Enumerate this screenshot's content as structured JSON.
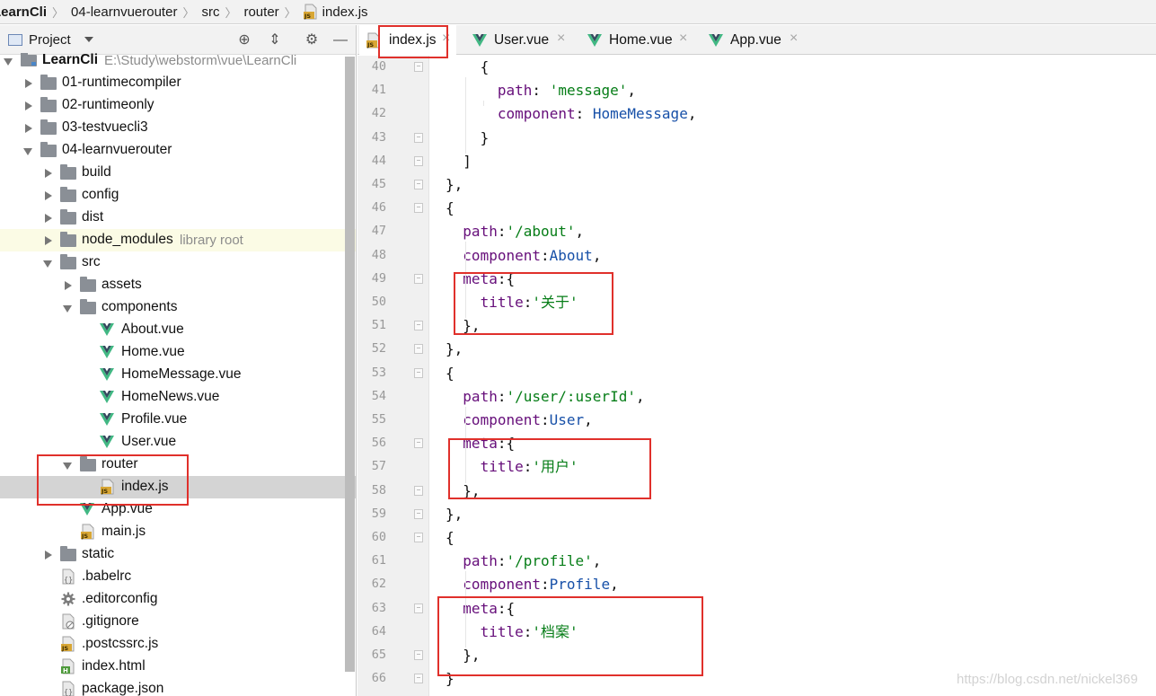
{
  "breadcrumb": [
    "LearnCli",
    "04-learnvuerouter",
    "src",
    "router",
    "index.js"
  ],
  "project_panel": {
    "title": "Project",
    "tools": [
      "crosshair-icon",
      "collapse-icon",
      "gear-icon",
      "minimize-icon"
    ],
    "tree": [
      {
        "label": "LearnCli",
        "hint": "E:\\Study\\webstorm\\vue\\LearnCli",
        "kind": "module",
        "depth": 0,
        "state": "open",
        "bold": true
      },
      {
        "label": "01-runtimecompiler",
        "kind": "folder",
        "depth": 1,
        "state": "closed"
      },
      {
        "label": "02-runtimeonly",
        "kind": "folder",
        "depth": 1,
        "state": "closed"
      },
      {
        "label": "03-testvuecli3",
        "kind": "folder",
        "depth": 1,
        "state": "closed"
      },
      {
        "label": "04-learnvuerouter",
        "kind": "folder",
        "depth": 1,
        "state": "open"
      },
      {
        "label": "build",
        "kind": "folder",
        "depth": 2,
        "state": "closed"
      },
      {
        "label": "config",
        "kind": "folder",
        "depth": 2,
        "state": "closed"
      },
      {
        "label": "dist",
        "kind": "folder",
        "depth": 2,
        "state": "closed"
      },
      {
        "label": "node_modules",
        "hint": "library root",
        "kind": "folder",
        "depth": 2,
        "state": "closed",
        "libroot": true
      },
      {
        "label": "src",
        "kind": "folder",
        "depth": 2,
        "state": "open"
      },
      {
        "label": "assets",
        "kind": "folder",
        "depth": 3,
        "state": "closed"
      },
      {
        "label": "components",
        "kind": "folder",
        "depth": 3,
        "state": "open"
      },
      {
        "label": "About.vue",
        "kind": "vue",
        "depth": 4
      },
      {
        "label": "Home.vue",
        "kind": "vue",
        "depth": 4
      },
      {
        "label": "HomeMessage.vue",
        "kind": "vue",
        "depth": 4
      },
      {
        "label": "HomeNews.vue",
        "kind": "vue",
        "depth": 4
      },
      {
        "label": "Profile.vue",
        "kind": "vue",
        "depth": 4
      },
      {
        "label": "User.vue",
        "kind": "vue",
        "depth": 4
      },
      {
        "label": "router",
        "kind": "folder",
        "depth": 3,
        "state": "open"
      },
      {
        "label": "index.js",
        "kind": "js",
        "depth": 4,
        "selected": true
      },
      {
        "label": "App.vue",
        "kind": "vue",
        "depth": 3
      },
      {
        "label": "main.js",
        "kind": "js",
        "depth": 3
      },
      {
        "label": "static",
        "kind": "folder",
        "depth": 2,
        "state": "closed"
      },
      {
        "label": ".babelrc",
        "kind": "config",
        "depth": 2
      },
      {
        "label": ".editorconfig",
        "kind": "settings",
        "depth": 2
      },
      {
        "label": ".gitignore",
        "kind": "ignore",
        "depth": 2
      },
      {
        "label": ".postcssrc.js",
        "kind": "js",
        "depth": 2
      },
      {
        "label": "index.html",
        "kind": "html",
        "depth": 2
      },
      {
        "label": "package.json",
        "kind": "config",
        "depth": 2
      }
    ]
  },
  "editor": {
    "tabs": [
      {
        "label": "index.js",
        "kind": "js",
        "active": true
      },
      {
        "label": "User.vue",
        "kind": "vue"
      },
      {
        "label": "Home.vue",
        "kind": "vue"
      },
      {
        "label": "App.vue",
        "kind": "vue"
      }
    ],
    "lines": [
      {
        "n": 40,
        "fold": true,
        "indent": 2,
        "tokens": [
          [
            "{",
            "p"
          ]
        ]
      },
      {
        "n": 41,
        "indent": 3,
        "tokens": [
          [
            "path",
            "k"
          ],
          [
            ": ",
            "p"
          ],
          [
            "'message'",
            "s"
          ],
          [
            ",",
            "p"
          ]
        ]
      },
      {
        "n": 42,
        "indent": 3,
        "tokens": [
          [
            "component",
            "k"
          ],
          [
            ": ",
            "p"
          ],
          [
            "HomeMessage",
            "i"
          ],
          [
            ",",
            "p"
          ]
        ]
      },
      {
        "n": 43,
        "fold": true,
        "indent": 2,
        "tokens": [
          [
            "}",
            "p"
          ]
        ]
      },
      {
        "n": 44,
        "fold": true,
        "indent": 1,
        "tokens": [
          [
            "]",
            "p"
          ]
        ]
      },
      {
        "n": 45,
        "fold": true,
        "indent": 0,
        "tokens": [
          [
            "},",
            "p"
          ]
        ]
      },
      {
        "n": 46,
        "fold": true,
        "indent": 0,
        "tokens": [
          [
            "{",
            "p"
          ]
        ]
      },
      {
        "n": 47,
        "indent": 1,
        "tokens": [
          [
            "path",
            "k"
          ],
          [
            ":",
            "p"
          ],
          [
            "'/about'",
            "s"
          ],
          [
            ",",
            "p"
          ]
        ]
      },
      {
        "n": 48,
        "indent": 1,
        "tokens": [
          [
            "component",
            "k"
          ],
          [
            ":",
            "p"
          ],
          [
            "About",
            "i"
          ],
          [
            ",",
            "p"
          ]
        ]
      },
      {
        "n": 49,
        "fold": true,
        "indent": 1,
        "tokens": [
          [
            "meta",
            "k"
          ],
          [
            ":{",
            "p"
          ]
        ]
      },
      {
        "n": 50,
        "indent": 2,
        "tokens": [
          [
            "title",
            "k"
          ],
          [
            ":",
            "p"
          ],
          [
            "'关于'",
            "s"
          ]
        ]
      },
      {
        "n": 51,
        "fold": true,
        "indent": 1,
        "tokens": [
          [
            "},",
            "p"
          ]
        ]
      },
      {
        "n": 52,
        "fold": true,
        "indent": 0,
        "tokens": [
          [
            "},",
            "p"
          ]
        ]
      },
      {
        "n": 53,
        "fold": true,
        "indent": 0,
        "tokens": [
          [
            "{",
            "p"
          ]
        ]
      },
      {
        "n": 54,
        "indent": 1,
        "tokens": [
          [
            "path",
            "k"
          ],
          [
            ":",
            "p"
          ],
          [
            "'/user/:userId'",
            "s"
          ],
          [
            ",",
            "p"
          ]
        ]
      },
      {
        "n": 55,
        "indent": 1,
        "tokens": [
          [
            "component",
            "k"
          ],
          [
            ":",
            "p"
          ],
          [
            "User",
            "i"
          ],
          [
            ",",
            "p"
          ]
        ]
      },
      {
        "n": 56,
        "fold": true,
        "indent": 1,
        "tokens": [
          [
            "meta",
            "k"
          ],
          [
            ":{",
            "p"
          ]
        ]
      },
      {
        "n": 57,
        "indent": 2,
        "tokens": [
          [
            "title",
            "k"
          ],
          [
            ":",
            "p"
          ],
          [
            "'用户'",
            "s"
          ]
        ]
      },
      {
        "n": 58,
        "fold": true,
        "indent": 1,
        "tokens": [
          [
            "},",
            "p"
          ]
        ]
      },
      {
        "n": 59,
        "fold": true,
        "indent": 0,
        "tokens": [
          [
            "},",
            "p"
          ]
        ]
      },
      {
        "n": 60,
        "fold": true,
        "indent": 0,
        "tokens": [
          [
            "{",
            "p"
          ]
        ]
      },
      {
        "n": 61,
        "indent": 1,
        "tokens": [
          [
            "path",
            "k"
          ],
          [
            ":",
            "p"
          ],
          [
            "'/profile'",
            "s"
          ],
          [
            ",",
            "p"
          ]
        ]
      },
      {
        "n": 62,
        "indent": 1,
        "tokens": [
          [
            "component",
            "k"
          ],
          [
            ":",
            "p"
          ],
          [
            "Profile",
            "i"
          ],
          [
            ",",
            "p"
          ]
        ]
      },
      {
        "n": 63,
        "fold": true,
        "indent": 1,
        "tokens": [
          [
            "meta",
            "k"
          ],
          [
            ":{",
            "p"
          ]
        ]
      },
      {
        "n": 64,
        "indent": 2,
        "tokens": [
          [
            "title",
            "k"
          ],
          [
            ":",
            "p"
          ],
          [
            "'档案'",
            "s"
          ]
        ]
      },
      {
        "n": 65,
        "fold": true,
        "indent": 1,
        "tokens": [
          [
            "},",
            "p"
          ]
        ]
      },
      {
        "n": 66,
        "fold": true,
        "indent": 0,
        "tokens": [
          [
            "}",
            "p"
          ]
        ]
      }
    ]
  },
  "annotation_color": "#e0302b",
  "watermark": "https://blog.csdn.net/nickel369"
}
